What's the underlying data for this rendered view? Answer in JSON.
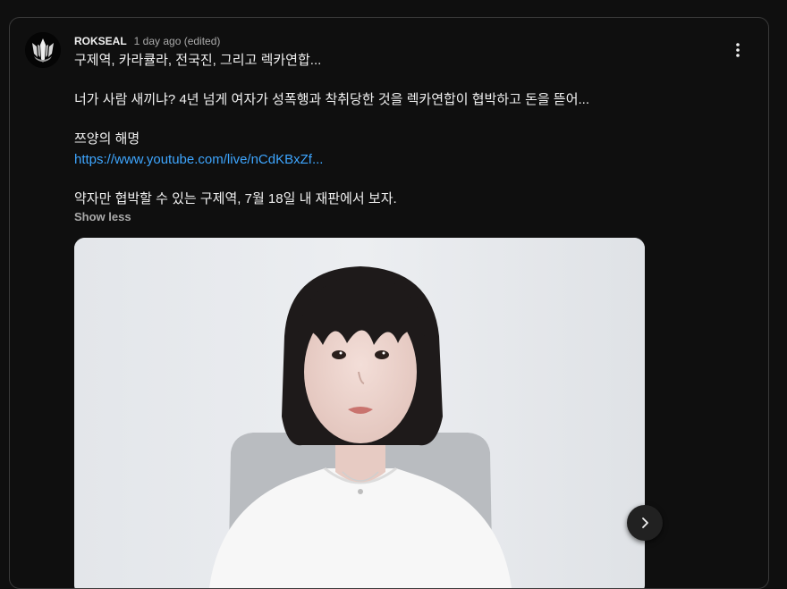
{
  "comment": {
    "author": "ROKSEAL",
    "time": "1 day ago (edited)",
    "lines": [
      "구제역, 카라큘라, 전국진, 그리고 렉카연합...",
      "너가 사람 새끼냐? 4년 넘게 여자가 성폭행과 착취당한 것을 렉카연합이 협박하고 돈을 뜯어...",
      "쯔양의 해명",
      "https://www.youtube.com/live/nCdKBxZf...",
      "약자만 협박할 수 있는 구제역, 7월 18일 내 재판에서 보자."
    ],
    "show_less": "Show less"
  },
  "icons": {
    "menu": "more-vertical-icon",
    "next": "chevron-right-icon",
    "avatar": "trident-logo"
  },
  "colors": {
    "background": "#0f0f0f",
    "text": "#f1f1f1",
    "secondary_text": "#aaaaaa",
    "link": "#3ea6ff",
    "card_border": "#3a3a3a"
  }
}
